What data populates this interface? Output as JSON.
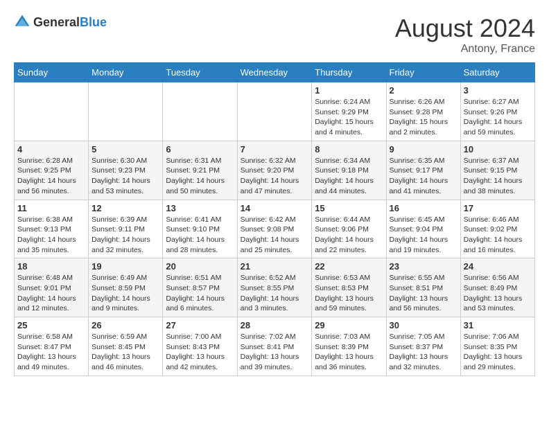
{
  "header": {
    "logo_general": "General",
    "logo_blue": "Blue",
    "month_year": "August 2024",
    "location": "Antony, France"
  },
  "days_of_week": [
    "Sunday",
    "Monday",
    "Tuesday",
    "Wednesday",
    "Thursday",
    "Friday",
    "Saturday"
  ],
  "weeks": [
    [
      {
        "day": "",
        "info": ""
      },
      {
        "day": "",
        "info": ""
      },
      {
        "day": "",
        "info": ""
      },
      {
        "day": "",
        "info": ""
      },
      {
        "day": "1",
        "info": "Sunrise: 6:24 AM\nSunset: 9:29 PM\nDaylight: 15 hours\nand 4 minutes."
      },
      {
        "day": "2",
        "info": "Sunrise: 6:26 AM\nSunset: 9:28 PM\nDaylight: 15 hours\nand 2 minutes."
      },
      {
        "day": "3",
        "info": "Sunrise: 6:27 AM\nSunset: 9:26 PM\nDaylight: 14 hours\nand 59 minutes."
      }
    ],
    [
      {
        "day": "4",
        "info": "Sunrise: 6:28 AM\nSunset: 9:25 PM\nDaylight: 14 hours\nand 56 minutes."
      },
      {
        "day": "5",
        "info": "Sunrise: 6:30 AM\nSunset: 9:23 PM\nDaylight: 14 hours\nand 53 minutes."
      },
      {
        "day": "6",
        "info": "Sunrise: 6:31 AM\nSunset: 9:21 PM\nDaylight: 14 hours\nand 50 minutes."
      },
      {
        "day": "7",
        "info": "Sunrise: 6:32 AM\nSunset: 9:20 PM\nDaylight: 14 hours\nand 47 minutes."
      },
      {
        "day": "8",
        "info": "Sunrise: 6:34 AM\nSunset: 9:18 PM\nDaylight: 14 hours\nand 44 minutes."
      },
      {
        "day": "9",
        "info": "Sunrise: 6:35 AM\nSunset: 9:17 PM\nDaylight: 14 hours\nand 41 minutes."
      },
      {
        "day": "10",
        "info": "Sunrise: 6:37 AM\nSunset: 9:15 PM\nDaylight: 14 hours\nand 38 minutes."
      }
    ],
    [
      {
        "day": "11",
        "info": "Sunrise: 6:38 AM\nSunset: 9:13 PM\nDaylight: 14 hours\nand 35 minutes."
      },
      {
        "day": "12",
        "info": "Sunrise: 6:39 AM\nSunset: 9:11 PM\nDaylight: 14 hours\nand 32 minutes."
      },
      {
        "day": "13",
        "info": "Sunrise: 6:41 AM\nSunset: 9:10 PM\nDaylight: 14 hours\nand 28 minutes."
      },
      {
        "day": "14",
        "info": "Sunrise: 6:42 AM\nSunset: 9:08 PM\nDaylight: 14 hours\nand 25 minutes."
      },
      {
        "day": "15",
        "info": "Sunrise: 6:44 AM\nSunset: 9:06 PM\nDaylight: 14 hours\nand 22 minutes."
      },
      {
        "day": "16",
        "info": "Sunrise: 6:45 AM\nSunset: 9:04 PM\nDaylight: 14 hours\nand 19 minutes."
      },
      {
        "day": "17",
        "info": "Sunrise: 6:46 AM\nSunset: 9:02 PM\nDaylight: 14 hours\nand 16 minutes."
      }
    ],
    [
      {
        "day": "18",
        "info": "Sunrise: 6:48 AM\nSunset: 9:01 PM\nDaylight: 14 hours\nand 12 minutes."
      },
      {
        "day": "19",
        "info": "Sunrise: 6:49 AM\nSunset: 8:59 PM\nDaylight: 14 hours\nand 9 minutes."
      },
      {
        "day": "20",
        "info": "Sunrise: 6:51 AM\nSunset: 8:57 PM\nDaylight: 14 hours\nand 6 minutes."
      },
      {
        "day": "21",
        "info": "Sunrise: 6:52 AM\nSunset: 8:55 PM\nDaylight: 14 hours\nand 3 minutes."
      },
      {
        "day": "22",
        "info": "Sunrise: 6:53 AM\nSunset: 8:53 PM\nDaylight: 13 hours\nand 59 minutes."
      },
      {
        "day": "23",
        "info": "Sunrise: 6:55 AM\nSunset: 8:51 PM\nDaylight: 13 hours\nand 56 minutes."
      },
      {
        "day": "24",
        "info": "Sunrise: 6:56 AM\nSunset: 8:49 PM\nDaylight: 13 hours\nand 53 minutes."
      }
    ],
    [
      {
        "day": "25",
        "info": "Sunrise: 6:58 AM\nSunset: 8:47 PM\nDaylight: 13 hours\nand 49 minutes."
      },
      {
        "day": "26",
        "info": "Sunrise: 6:59 AM\nSunset: 8:45 PM\nDaylight: 13 hours\nand 46 minutes."
      },
      {
        "day": "27",
        "info": "Sunrise: 7:00 AM\nSunset: 8:43 PM\nDaylight: 13 hours\nand 42 minutes."
      },
      {
        "day": "28",
        "info": "Sunrise: 7:02 AM\nSunset: 8:41 PM\nDaylight: 13 hours\nand 39 minutes."
      },
      {
        "day": "29",
        "info": "Sunrise: 7:03 AM\nSunset: 8:39 PM\nDaylight: 13 hours\nand 36 minutes."
      },
      {
        "day": "30",
        "info": "Sunrise: 7:05 AM\nSunset: 8:37 PM\nDaylight: 13 hours\nand 32 minutes."
      },
      {
        "day": "31",
        "info": "Sunrise: 7:06 AM\nSunset: 8:35 PM\nDaylight: 13 hours\nand 29 minutes."
      }
    ]
  ]
}
